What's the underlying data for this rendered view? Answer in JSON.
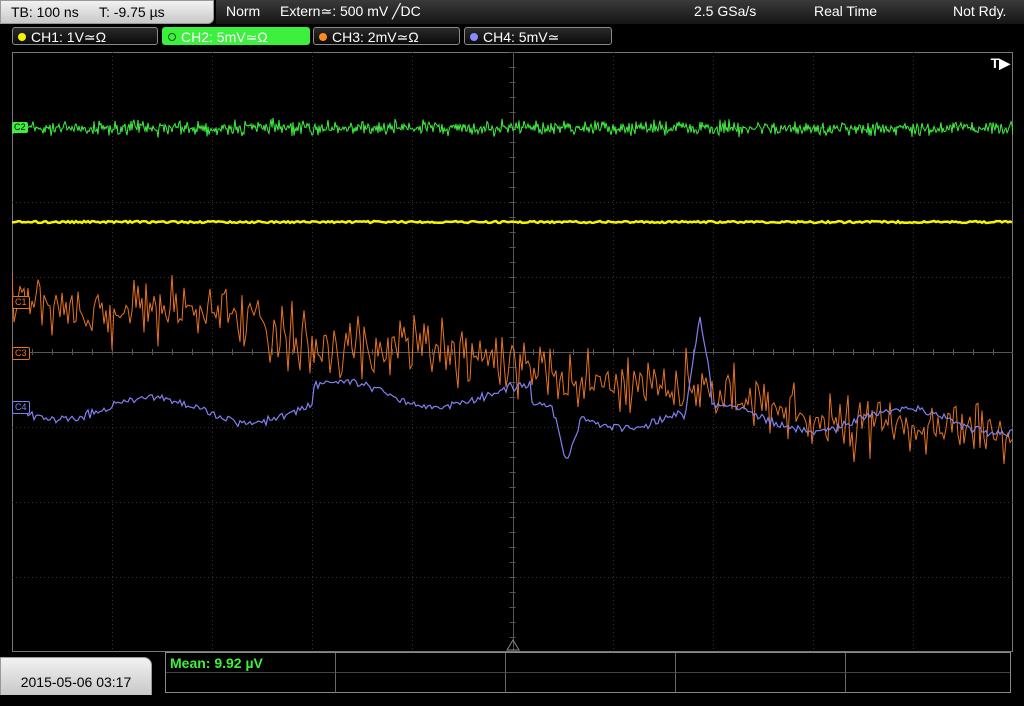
{
  "timebase": {
    "tb": "TB: 100 ns",
    "t": "T: -9.75 µs"
  },
  "trigger": {
    "mode": "Norm",
    "source": "Extern≃: 500 mV ╱DC",
    "rate": "2.5 GSa/s",
    "acq": "Real Time",
    "status": "Not Rdy."
  },
  "channels": [
    {
      "label": "CH1: 1V≃Ω",
      "color": "#f5f500",
      "active": false
    },
    {
      "label": "CH2: 5mV≃Ω",
      "color": "#3ef03e",
      "active": true
    },
    {
      "label": "CH3: 2mV≃Ω",
      "color": "#ff8a1f",
      "active": false
    },
    {
      "label": "CH4: 5mV≃",
      "color": "#8a8aff",
      "active": false
    }
  ],
  "markers": {
    "c2": "C2",
    "c1": "C1",
    "c3": "C3",
    "c4": "C4"
  },
  "trigger_flag": "T▶",
  "measurement": {
    "mean": "Mean: 9.92 µV"
  },
  "datetime": "2015-05-06 03:17",
  "colors": {
    "ch1": "#f5f500",
    "ch2": "#3ef03e",
    "ch3": "#e8741c",
    "ch4": "#8080f0",
    "grid": "#3a3a3a"
  }
}
